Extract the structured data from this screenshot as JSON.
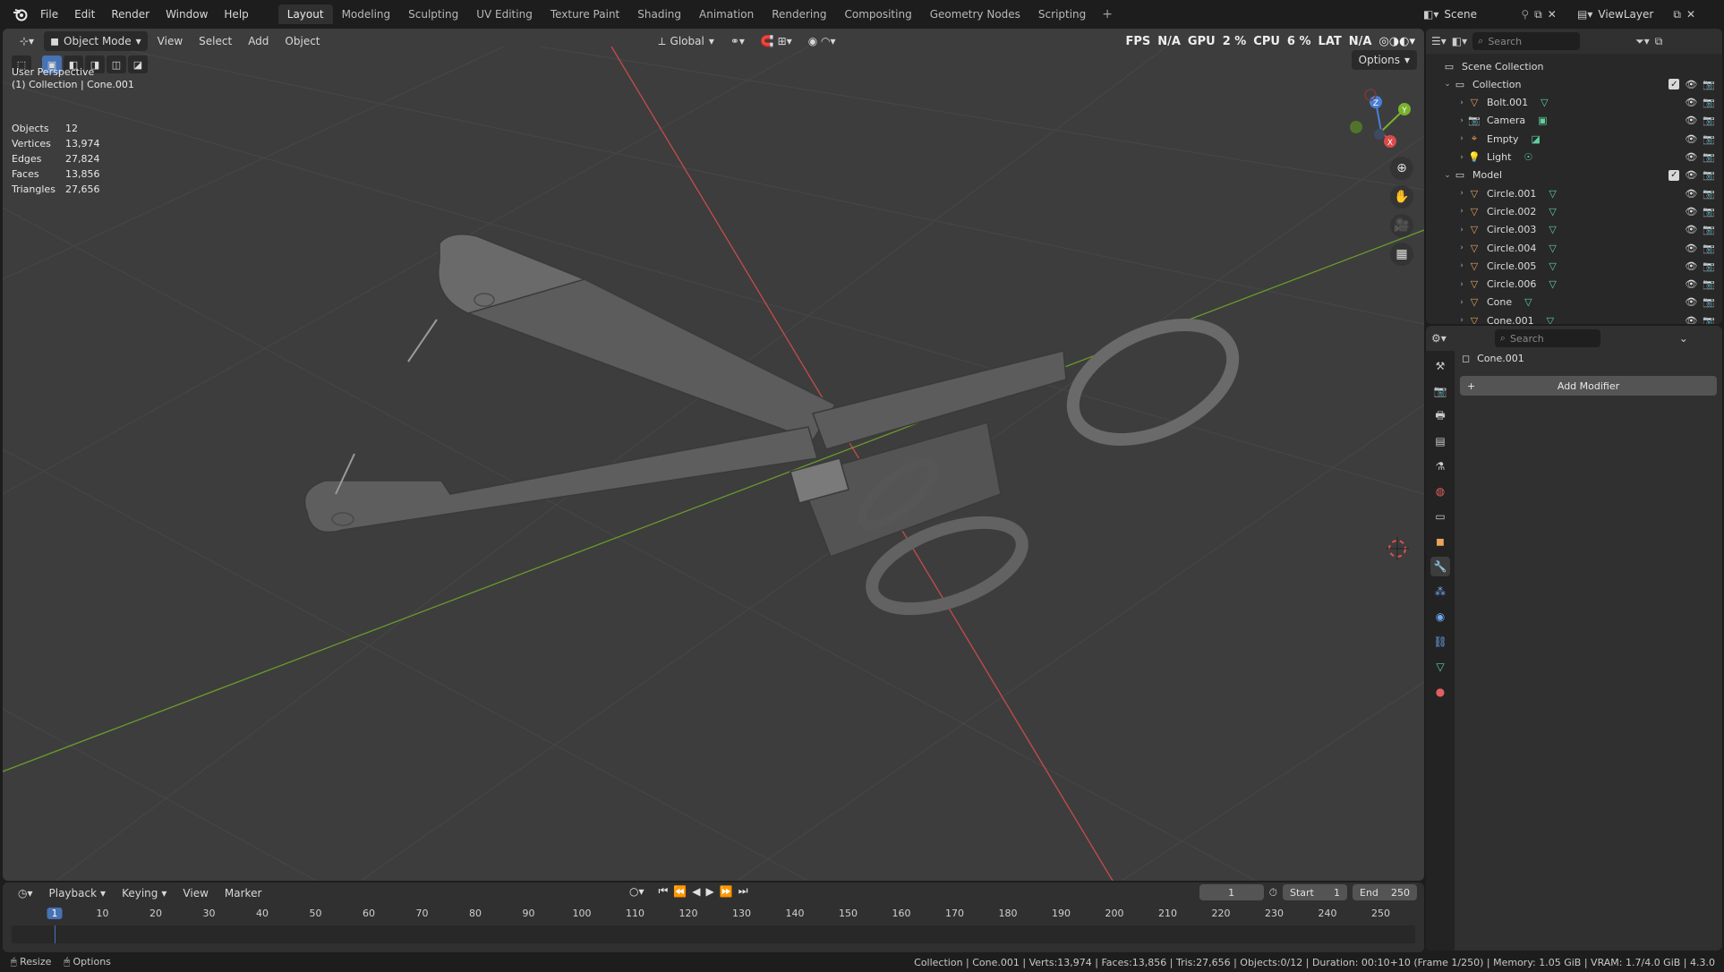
{
  "topbar": {
    "menus": [
      "File",
      "Edit",
      "Render",
      "Window",
      "Help"
    ],
    "workspaces": [
      "Layout",
      "Modeling",
      "Sculpting",
      "UV Editing",
      "Texture Paint",
      "Shading",
      "Animation",
      "Rendering",
      "Compositing",
      "Geometry Nodes",
      "Scripting"
    ],
    "active_workspace": "Layout",
    "add_workspace": "+",
    "scene": "Scene",
    "view_layer": "ViewLayer"
  },
  "viewport": {
    "mode": "Object Mode",
    "menus": [
      "View",
      "Select",
      "Add",
      "Object"
    ],
    "orientation": "Global",
    "options_label": "Options",
    "perspective": "User Perspective",
    "collection_line": "(1) Collection | Cone.001",
    "hud": {
      "fps_label": "FPS",
      "fps_value": "N/A",
      "gpu_label": "GPU",
      "gpu_value": "2 %",
      "cpu_label": "CPU",
      "cpu_value": "6 %",
      "lat_label": "LAT",
      "lat_value": "N/A"
    },
    "stats": [
      {
        "label": "Objects",
        "value": "12"
      },
      {
        "label": "Vertices",
        "value": "13,974"
      },
      {
        "label": "Edges",
        "value": "27,824"
      },
      {
        "label": "Faces",
        "value": "13,856"
      },
      {
        "label": "Triangles",
        "value": "27,656"
      }
    ],
    "gizmo_axes": {
      "z": "Z",
      "y": "Y",
      "x": "X"
    },
    "colors": {
      "bg": "#3d3d3d",
      "grid": "#4a4a4a",
      "x_axis": "#c74b4b",
      "y_axis": "#6b9a2c",
      "mesh": "#5a5a5a"
    }
  },
  "timeline": {
    "menus": [
      "Playback",
      "Keying",
      "View",
      "Marker"
    ],
    "current_frame": "1",
    "start_label": "Start",
    "start": "1",
    "end_label": "End",
    "end": "250",
    "ticks": [
      "10",
      "20",
      "30",
      "40",
      "50",
      "60",
      "70",
      "80",
      "90",
      "100",
      "110",
      "120",
      "130",
      "140",
      "150",
      "160",
      "170",
      "180",
      "190",
      "200",
      "210",
      "220",
      "230",
      "240",
      "250"
    ],
    "playhead": "1"
  },
  "statusbar": {
    "left": [
      "Resize",
      "Options"
    ],
    "right": "Collection | Cone.001 | Verts:13,974 | Faces:13,856 | Tris:27,656 | Objects:0/12 | Duration: 00:10+10 (Frame 1/250) | Memory: 1.05 GiB | VRAM: 1.7/4.0 GiB | 4.3.0"
  },
  "outliner": {
    "search_placeholder": "Search",
    "scene_collection": "Scene Collection",
    "collections": [
      {
        "name": "Collection",
        "items": [
          {
            "name": "Bolt.001",
            "type": "mesh"
          },
          {
            "name": "Camera",
            "type": "camera"
          },
          {
            "name": "Empty",
            "type": "empty"
          },
          {
            "name": "Light",
            "type": "light"
          }
        ]
      },
      {
        "name": "Model",
        "items": [
          {
            "name": "Circle.001",
            "type": "mesh"
          },
          {
            "name": "Circle.002",
            "type": "mesh"
          },
          {
            "name": "Circle.003",
            "type": "mesh"
          },
          {
            "name": "Circle.004",
            "type": "mesh"
          },
          {
            "name": "Circle.005",
            "type": "mesh"
          },
          {
            "name": "Circle.006",
            "type": "mesh"
          },
          {
            "name": "Cone",
            "type": "mesh"
          },
          {
            "name": "Cone.001",
            "type": "mesh"
          }
        ]
      }
    ]
  },
  "properties": {
    "search_placeholder": "Search",
    "object_name": "Cone.001",
    "add_modifier": "Add Modifier",
    "add_modifier_icon": "+"
  }
}
